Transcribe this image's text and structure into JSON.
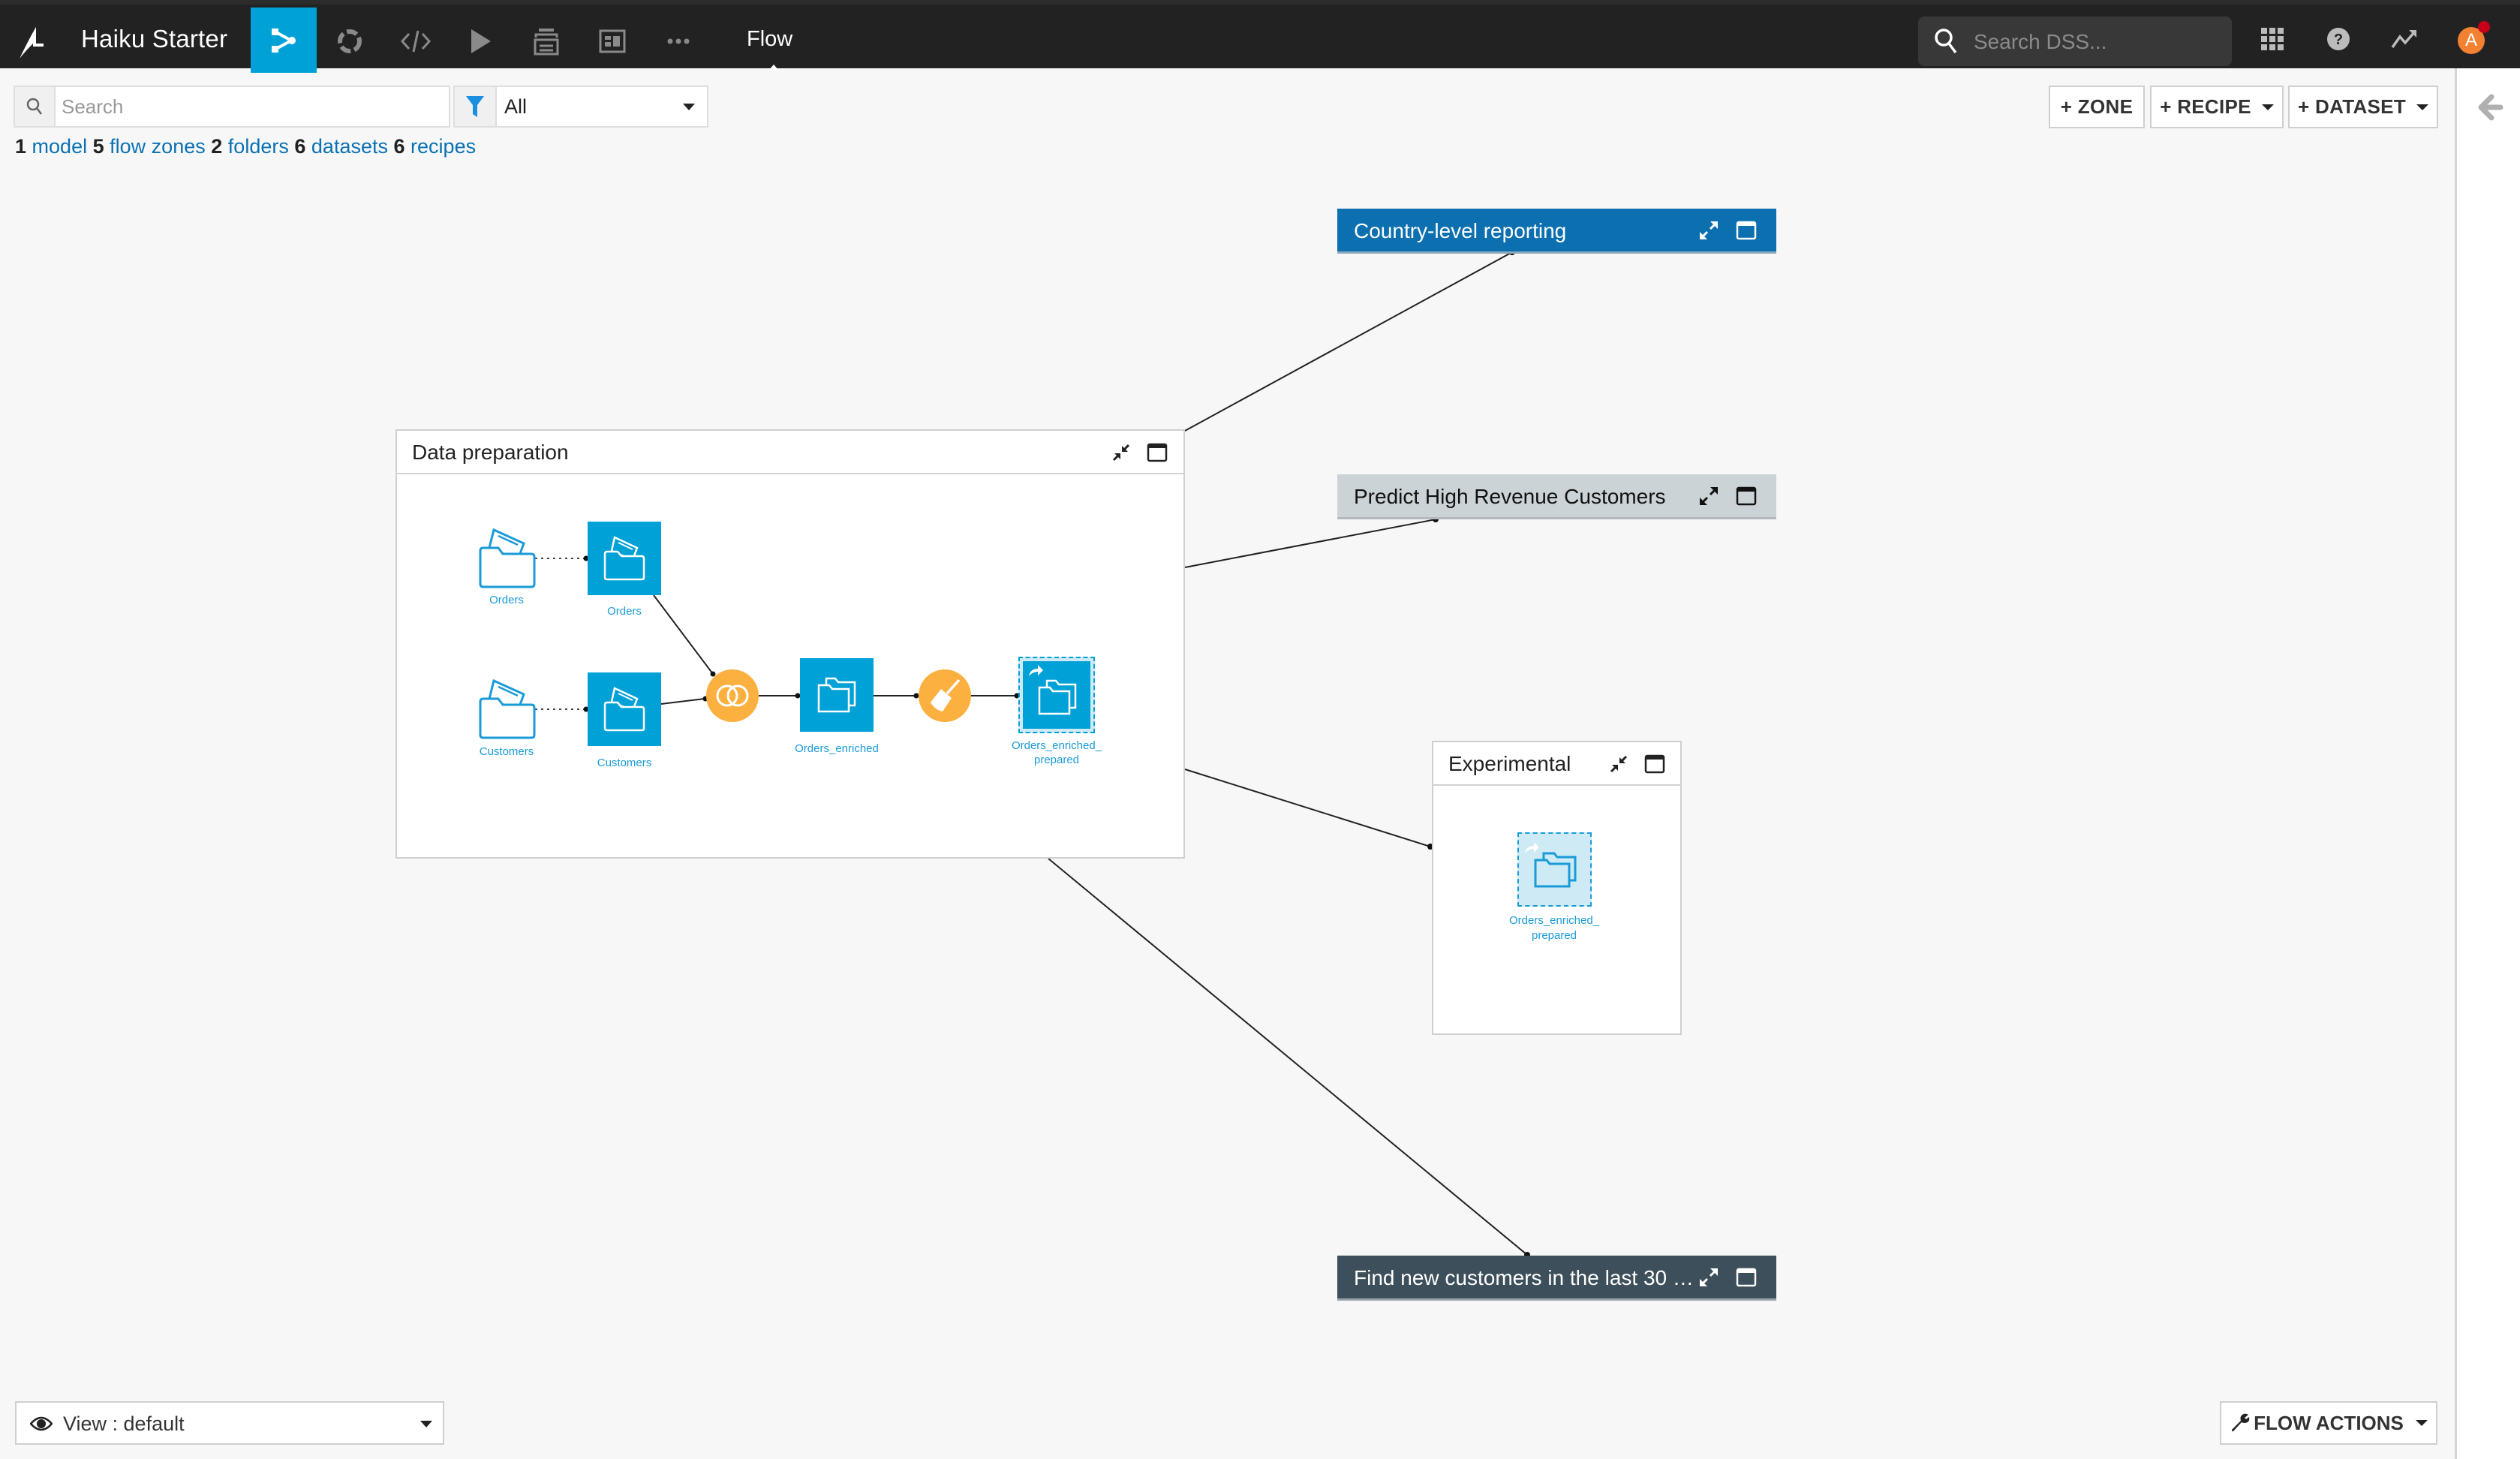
{
  "topbar": {
    "app_title": "Haiku Starter",
    "nav_icons": [
      "flow-icon",
      "lab-icon",
      "code-icon",
      "jobs-icon",
      "library-icon",
      "dashboard-icon",
      "more-icon"
    ],
    "current_section": "Flow",
    "search_placeholder": "Search DSS...",
    "avatar_initial": "A",
    "accent_color": "#00a1d6"
  },
  "toolbar": {
    "search_placeholder": "Search",
    "filter_value": "All",
    "counts": [
      {
        "num": "1",
        "label": "model"
      },
      {
        "num": "5",
        "label": "flow zones"
      },
      {
        "num": "2",
        "label": "folders"
      },
      {
        "num": "6",
        "label": "datasets"
      },
      {
        "num": "6",
        "label": "recipes"
      }
    ],
    "zone_button": "+ ZONE",
    "recipe_button": "+ RECIPE",
    "dataset_button": "+ DATASET"
  },
  "zones": {
    "data_preparation": {
      "title": "Data preparation",
      "nodes": {
        "orders_folder": "Orders",
        "orders_dataset": "Orders",
        "customers_folder": "Customers",
        "customers_dataset": "Customers",
        "orders_enriched": "Orders_enriched",
        "orders_enriched_prepared_line1": "Orders_enriched_",
        "orders_enriched_prepared_line2": "prepared"
      }
    },
    "country_reporting": {
      "title": "Country-level reporting",
      "color": "#0b6fb0"
    },
    "predict_high_revenue": {
      "title": "Predict High Revenue Customers",
      "color": "#cbd3d6"
    },
    "experimental": {
      "title": "Experimental",
      "node_line1": "Orders_enriched_",
      "node_line2": "prepared"
    },
    "find_new_customers": {
      "title": "Find new customers in the last 30 …",
      "color": "#3d4f5a"
    }
  },
  "bottom": {
    "view_label": "View : default",
    "flow_actions": "FLOW ACTIONS"
  }
}
